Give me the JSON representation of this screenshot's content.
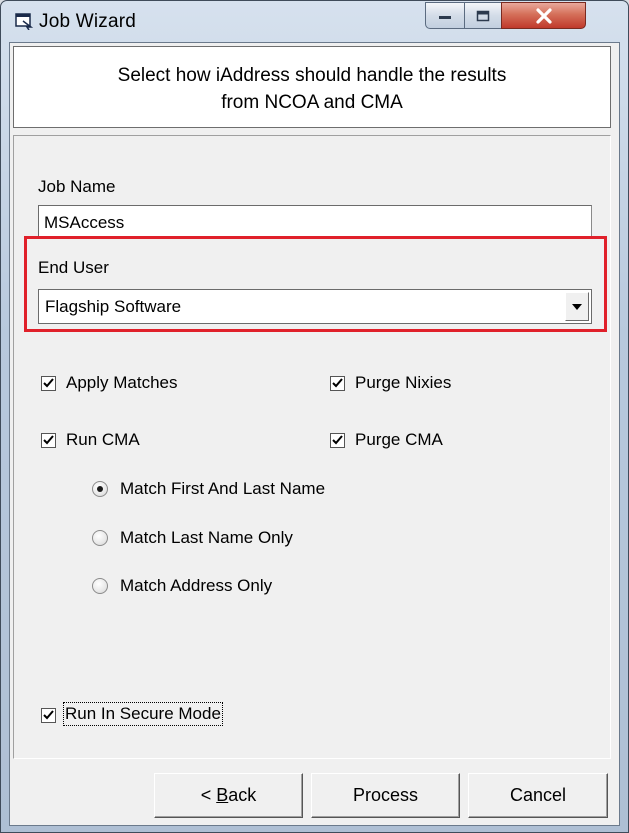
{
  "window": {
    "title": "Job Wizard",
    "icon": "app-window-icon"
  },
  "header": {
    "line1": "Select how iAddress should handle the results",
    "line2": "from NCOA and CMA"
  },
  "job_name": {
    "label": "Job Name",
    "value": "MSAccess"
  },
  "end_user": {
    "label": "End User",
    "selected": "Flagship Software"
  },
  "options": {
    "apply_matches": {
      "label": "Apply Matches",
      "checked": true
    },
    "purge_nixies": {
      "label": "Purge Nixies",
      "checked": true
    },
    "run_cma": {
      "label": "Run CMA",
      "checked": true
    },
    "purge_cma": {
      "label": "Purge CMA",
      "checked": true
    }
  },
  "match_mode": {
    "items": [
      {
        "label": "Match First And Last Name",
        "selected": true
      },
      {
        "label": "Match Last Name Only",
        "selected": false
      },
      {
        "label": "Match Address Only",
        "selected": false
      }
    ]
  },
  "secure_mode": {
    "label": "Run In Secure Mode",
    "checked": true
  },
  "buttons": {
    "back_prefix": "< ",
    "back_accel": "B",
    "back_rest": "ack",
    "process": "Process",
    "cancel": "Cancel"
  },
  "colors": {
    "highlight": "#e0202a"
  }
}
